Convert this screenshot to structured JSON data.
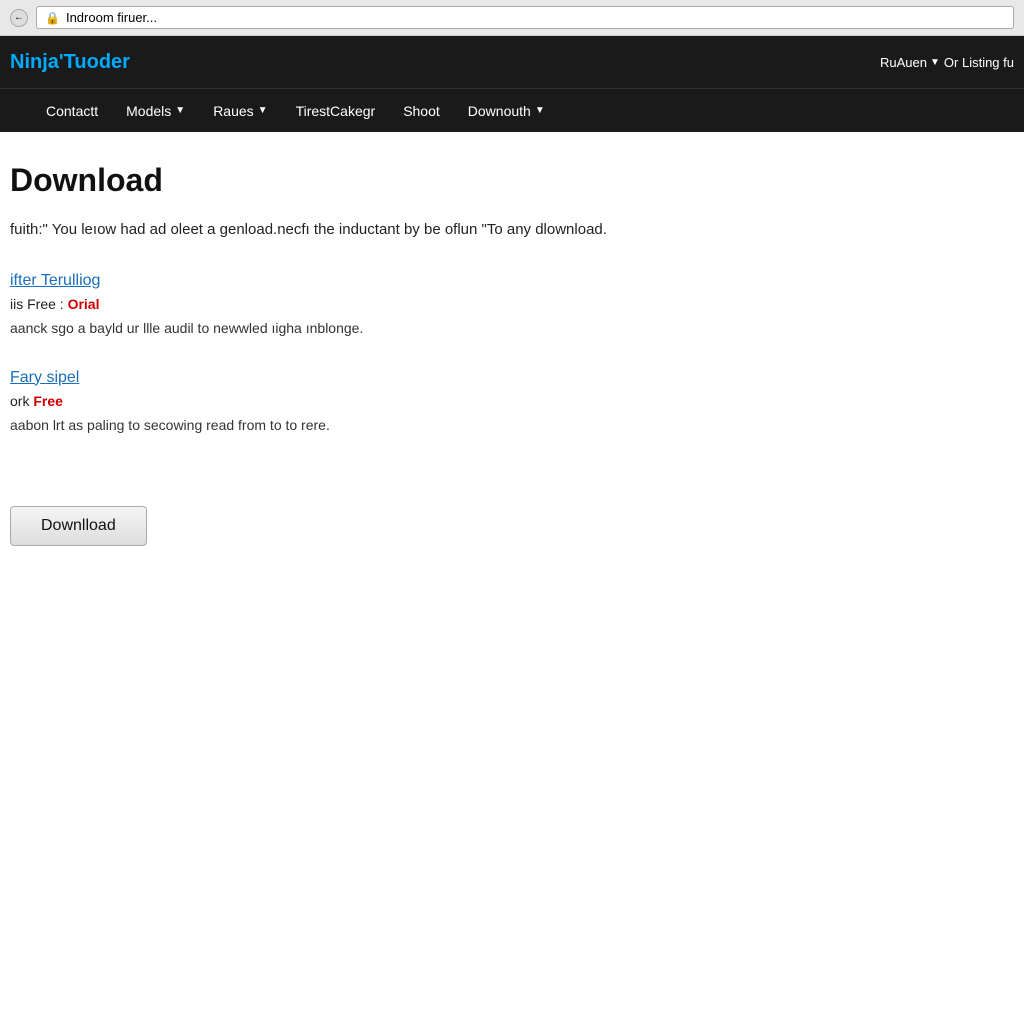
{
  "browser": {
    "address": "Indroom firuer...",
    "lock_symbol": "🔒"
  },
  "header": {
    "logo_part1": "Ninja",
    "logo_part2": "Tuoder",
    "logo_accent": ".",
    "user_label": "RuAuen",
    "listing_label": "Or Listing fu"
  },
  "nav": {
    "items": [
      {
        "label": "",
        "has_dropdown": false
      },
      {
        "label": "Contactt",
        "has_dropdown": false
      },
      {
        "label": "Models",
        "has_dropdown": true
      },
      {
        "label": "Raues",
        "has_dropdown": true
      },
      {
        "label": "TirestCakegr",
        "has_dropdown": false
      },
      {
        "label": "Shoot",
        "has_dropdown": false
      },
      {
        "label": "Downouth",
        "has_dropdown": true
      }
    ]
  },
  "main": {
    "page_title": "Download",
    "page_desc": "fuith:\" You leıow had ad oleet a genload.necfı the inductant by be oflun \"To any dlownload.",
    "items": [
      {
        "title": "ifter Terulliog",
        "meta_prefix": "iis Free :",
        "meta_value": "Orial",
        "desc": "aanck sgo a bayld ur llle audil to newwled ıigha ınblonge."
      },
      {
        "title": "Fary sipel",
        "meta_prefix": "ork",
        "meta_value": "Free",
        "desc": "aabon lrt as paling to secowing read from to to rere."
      }
    ],
    "download_button_label": "Downlload"
  }
}
